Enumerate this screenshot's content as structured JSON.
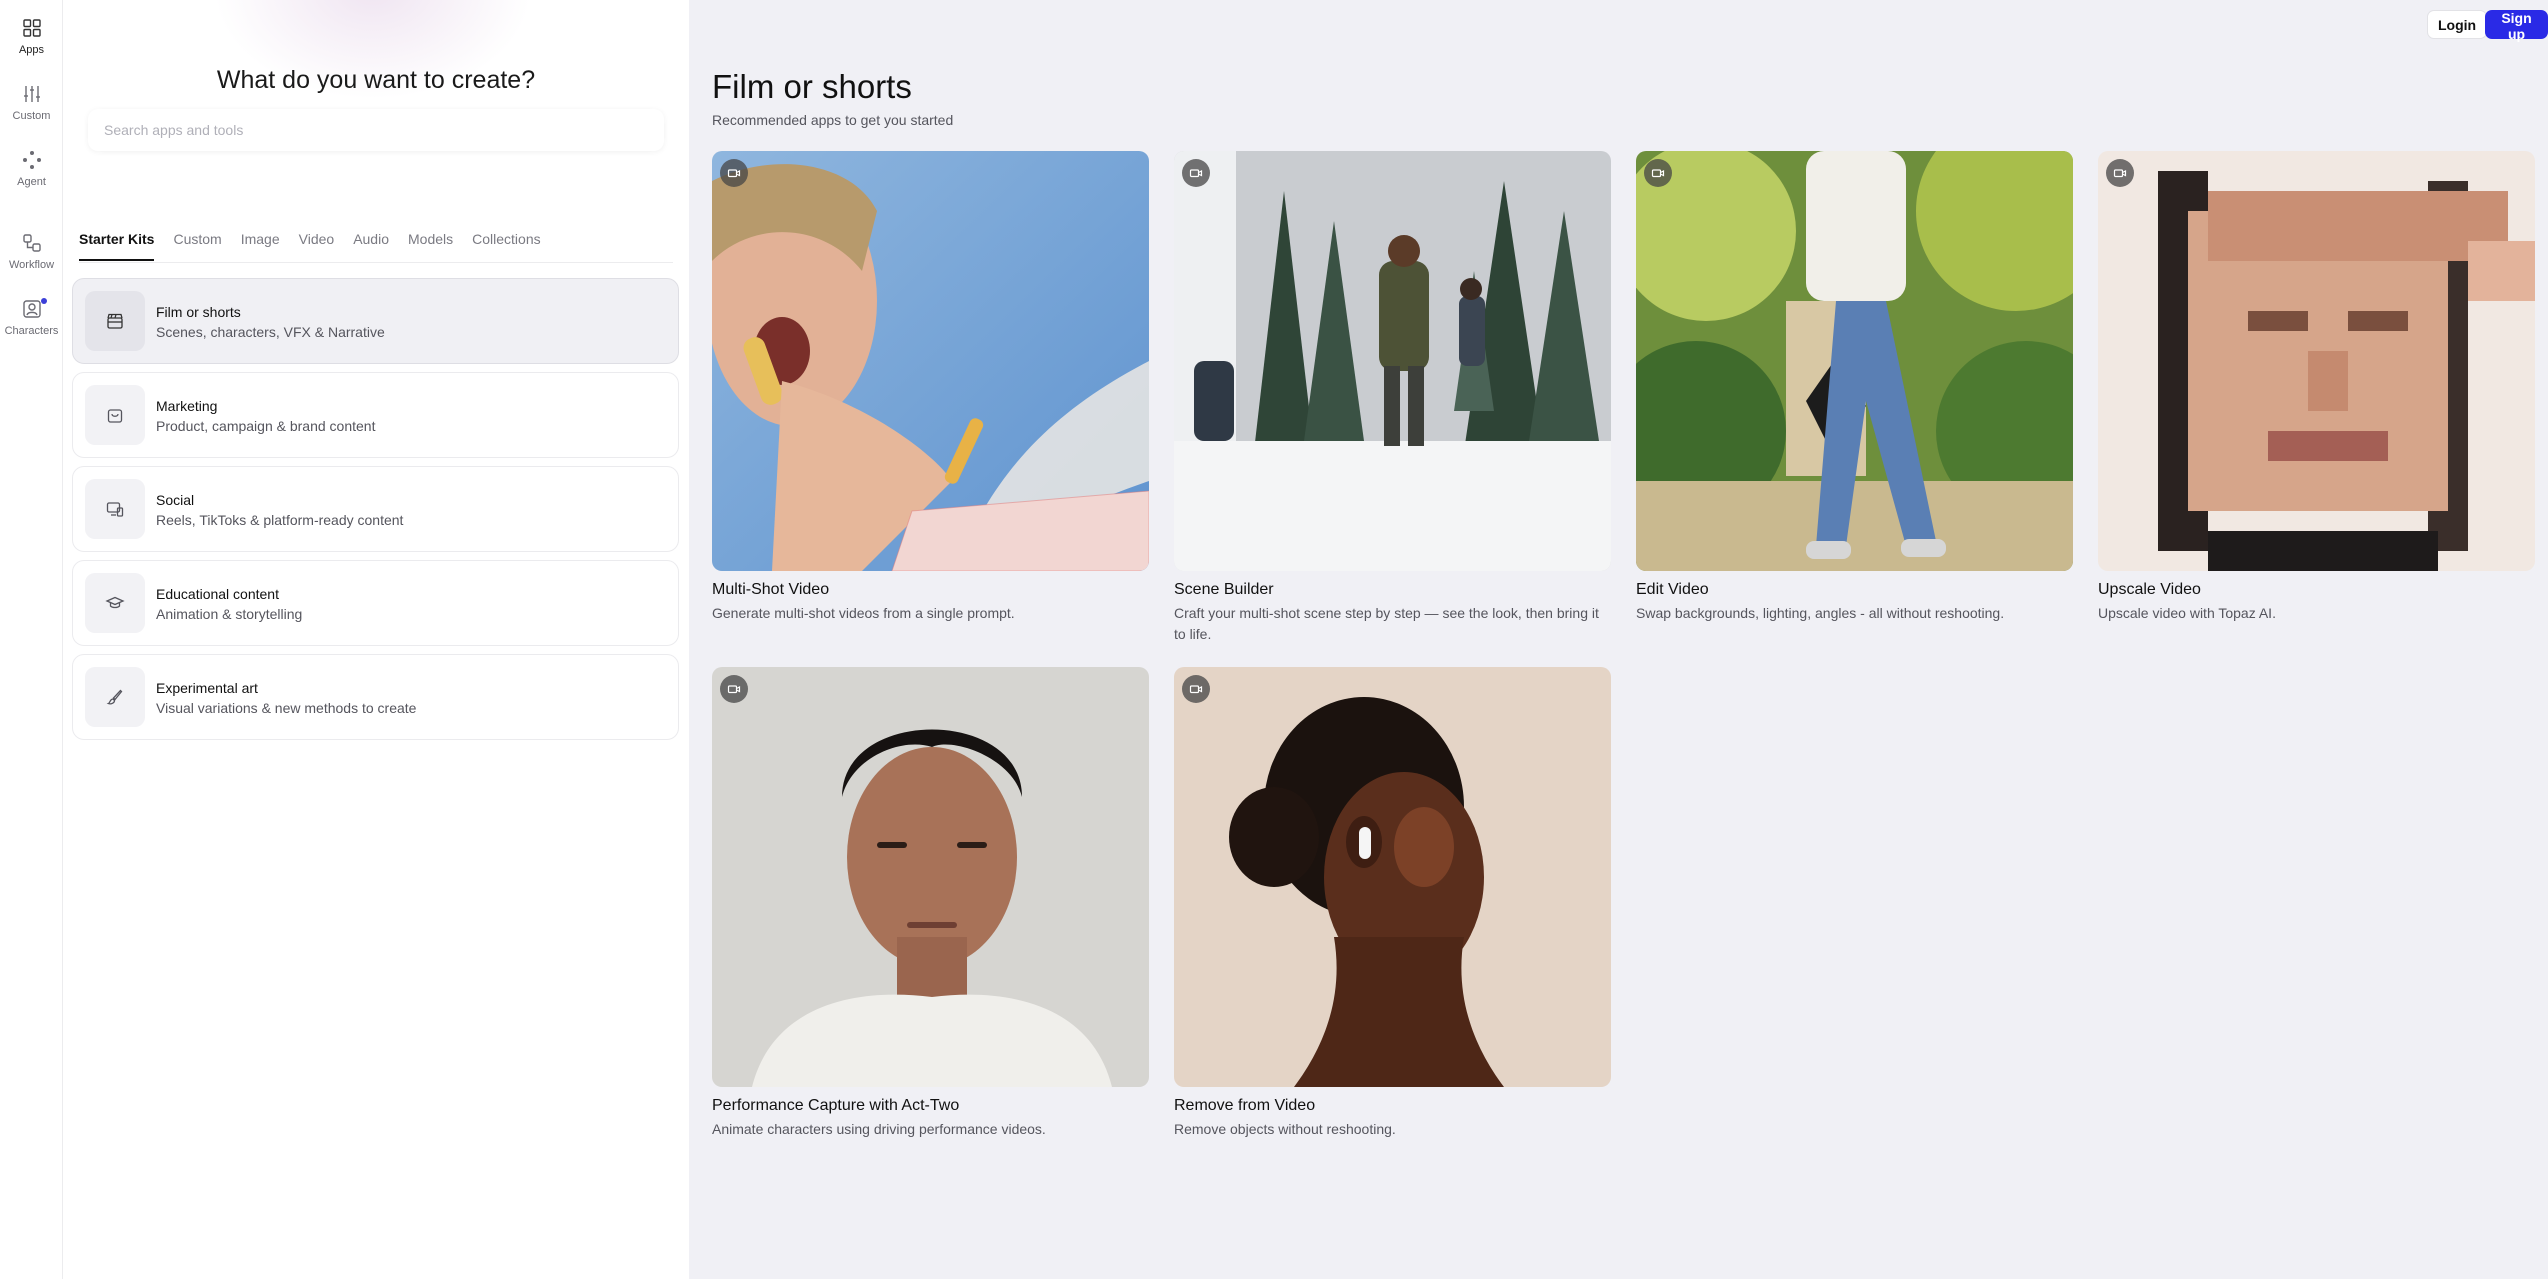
{
  "rail": {
    "items": [
      {
        "label": "Apps",
        "icon": "grid-icon"
      },
      {
        "label": "Custom",
        "icon": "sliders-icon"
      },
      {
        "label": "Agent",
        "icon": "sparkle-icon"
      },
      {
        "label": "Workflow",
        "icon": "workflow-icon"
      },
      {
        "label": "Characters",
        "icon": "character-icon"
      }
    ]
  },
  "panel": {
    "title": "What do you want to create?",
    "search_placeholder": "Search apps and tools",
    "tabs": [
      "Starter Kits",
      "Custom",
      "Image",
      "Video",
      "Audio",
      "Models",
      "Collections"
    ],
    "kits": [
      {
        "title": "Film or shorts",
        "subtitle": "Scenes, characters, VFX & Narrative",
        "icon": "clapperboard-icon"
      },
      {
        "title": "Marketing",
        "subtitle": "Product, campaign & brand content",
        "icon": "shopping-bag-icon"
      },
      {
        "title": "Social",
        "subtitle": "Reels, TikToks & platform-ready content",
        "icon": "devices-icon"
      },
      {
        "title": "Educational content",
        "subtitle": "Animation & storytelling",
        "icon": "graduation-cap-icon"
      },
      {
        "title": "Experimental art",
        "subtitle": "Visual variations & new methods to create",
        "icon": "brush-icon"
      }
    ]
  },
  "header": {
    "login": "Login",
    "signup": "Sign up"
  },
  "main": {
    "title": "Film or shorts",
    "subtitle": "Recommended apps to get you started",
    "cards": [
      {
        "title": "Multi-Shot Video",
        "desc": "Generate multi-shot videos from a single prompt."
      },
      {
        "title": "Scene Builder",
        "desc": "Craft your multi-shot scene step by step — see the look, then bring it to life."
      },
      {
        "title": "Edit Video",
        "desc": "Swap backgrounds, lighting, angles - all without reshooting."
      },
      {
        "title": "Upscale Video",
        "desc": "Upscale video with Topaz AI."
      },
      {
        "title": "Performance Capture with Act-Two",
        "desc": "Animate characters using driving performance videos."
      },
      {
        "title": "Remove from Video",
        "desc": "Remove objects without reshooting."
      }
    ]
  },
  "colors": {
    "accent": "#2a2ae6",
    "main_bg": "#f0f0f5",
    "notify_dot": "#3b3fd8"
  }
}
